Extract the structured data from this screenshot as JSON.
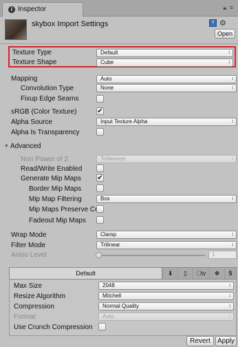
{
  "tab": {
    "label": "Inspector",
    "icon": "info-icon",
    "menu_glyphs": "≡"
  },
  "header": {
    "title": "skybox Import Settings",
    "open_label": "Open",
    "help_icon": "?",
    "gear_icon": "⚙"
  },
  "props": {
    "texture_type": {
      "label": "Texture Type",
      "value": "Default"
    },
    "texture_shape": {
      "label": "Texture Shape",
      "value": "Cube"
    },
    "mapping": {
      "label": "Mapping",
      "value": "Auto"
    },
    "convolution_type": {
      "label": "Convolution Type",
      "value": "None"
    },
    "fixup_edge_seams": {
      "label": "Fixup Edge Seams",
      "checked": false
    },
    "srgb": {
      "label": "sRGB (Color Texture)",
      "checked": true
    },
    "alpha_source": {
      "label": "Alpha Source",
      "value": "Input Texture Alpha"
    },
    "alpha_is_transparency": {
      "label": "Alpha Is Transparency",
      "checked": false
    }
  },
  "advanced": {
    "label": "Advanced",
    "non_power_of_2": {
      "label": "Non Power of 2",
      "value": "ToNearest"
    },
    "read_write": {
      "label": "Read/Write Enabled",
      "checked": false
    },
    "generate_mip_maps": {
      "label": "Generate Mip Maps",
      "checked": true
    },
    "border_mip_maps": {
      "label": "Border Mip Maps",
      "checked": false
    },
    "mip_map_filtering": {
      "label": "Mip Map Filtering",
      "value": "Box"
    },
    "mip_maps_preserve": {
      "label": "Mip Maps Preserve Co",
      "checked": false
    },
    "fadeout_mip_maps": {
      "label": "Fadeout Mip Maps",
      "checked": false
    }
  },
  "wrap": {
    "wrap_mode": {
      "label": "Wrap Mode",
      "value": "Clamp"
    },
    "filter_mode": {
      "label": "Filter Mode",
      "value": "Trilinear"
    },
    "aniso_level": {
      "label": "Aniso Level",
      "value": "1",
      "slider_fraction": 0.0
    }
  },
  "platform": {
    "default_tab": "Default",
    "icons": [
      "⬇",
      "▯",
      "tv",
      "❖",
      "5"
    ],
    "max_size": {
      "label": "Max Size",
      "value": "2048"
    },
    "resize_algorithm": {
      "label": "Resize Algorithm",
      "value": "Mitchell"
    },
    "compression": {
      "label": "Compression",
      "value": "Normal Quality"
    },
    "format": {
      "label": "Format",
      "value": "Auto"
    },
    "crunch": {
      "label": "Use Crunch Compression",
      "checked": false
    }
  },
  "buttons": {
    "revert": "Revert",
    "apply": "Apply"
  },
  "colors": {
    "highlight": "#d9232a",
    "background": "#c2c2c2"
  }
}
